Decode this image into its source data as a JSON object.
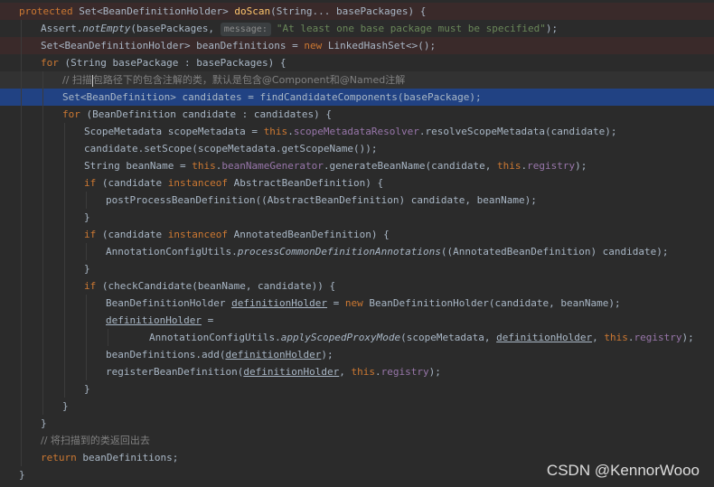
{
  "lines": [
    {
      "indent": 0,
      "hl": "hl-red",
      "segs": [
        {
          "t": "protected",
          "c": "kw"
        },
        {
          "t": " Set<BeanDefinitionHolder> "
        },
        {
          "t": "doScan",
          "c": "fn"
        },
        {
          "t": "(String... basePackages) {"
        }
      ]
    },
    {
      "indent": 1,
      "hl": "",
      "segs": [
        {
          "t": "Assert."
        },
        {
          "t": "notEmpty",
          "c": "it"
        },
        {
          "t": "(basePackages, "
        },
        {
          "t": "message:",
          "c": "hint"
        },
        {
          "t": "\"At least one base package must be specified\"",
          "c": "str"
        },
        {
          "t": ");"
        }
      ]
    },
    {
      "indent": 1,
      "hl": "hl-red",
      "segs": [
        {
          "t": "Set<BeanDefinitionHolder> beanDefinitions = "
        },
        {
          "t": "new",
          "c": "kw"
        },
        {
          "t": " LinkedHashSet<>();"
        }
      ]
    },
    {
      "indent": 1,
      "hl": "",
      "segs": [
        {
          "t": "for",
          "c": "kw"
        },
        {
          "t": " (String basePackage : basePackages) {"
        }
      ]
    },
    {
      "indent": 2,
      "hl": "hl-dim",
      "segs": [
        {
          "t": "// 扫描",
          "c": "cmt cjk"
        },
        {
          "t": "",
          "c": "caret"
        },
        {
          "t": "包路径下的包含注解的类，默认是包含@Component和@Named注解",
          "c": "cmt cjk"
        }
      ]
    },
    {
      "indent": 2,
      "hl": "hl-sel",
      "segs": [
        {
          "t": "Set<BeanDefinition> candidates = findCandidateComponents(basePackage);"
        }
      ]
    },
    {
      "indent": 2,
      "hl": "",
      "segs": [
        {
          "t": "for",
          "c": "kw"
        },
        {
          "t": " (BeanDefinition candidate : candidates) {"
        }
      ]
    },
    {
      "indent": 3,
      "hl": "",
      "segs": [
        {
          "t": "ScopeMetadata scopeMetadata = "
        },
        {
          "t": "this",
          "c": "kw"
        },
        {
          "t": "."
        },
        {
          "t": "scopeMetadataResolver",
          "c": "fld"
        },
        {
          "t": ".resolveScopeMetadata(candidate);"
        }
      ]
    },
    {
      "indent": 3,
      "hl": "",
      "segs": [
        {
          "t": "candidate.setScope(scopeMetadata.getScopeName());"
        }
      ]
    },
    {
      "indent": 3,
      "hl": "",
      "segs": [
        {
          "t": "String beanName = "
        },
        {
          "t": "this",
          "c": "kw"
        },
        {
          "t": "."
        },
        {
          "t": "beanNameGenerator",
          "c": "fld"
        },
        {
          "t": ".generateBeanName(candidate, "
        },
        {
          "t": "this",
          "c": "kw"
        },
        {
          "t": "."
        },
        {
          "t": "registry",
          "c": "fld"
        },
        {
          "t": ");"
        }
      ]
    },
    {
      "indent": 3,
      "hl": "",
      "segs": [
        {
          "t": "if",
          "c": "kw"
        },
        {
          "t": " (candidate "
        },
        {
          "t": "instanceof",
          "c": "kw"
        },
        {
          "t": " AbstractBeanDefinition) {"
        }
      ]
    },
    {
      "indent": 4,
      "hl": "",
      "segs": [
        {
          "t": "postProcessBeanDefinition((AbstractBeanDefinition) candidate, beanName);"
        }
      ]
    },
    {
      "indent": 3,
      "hl": "",
      "segs": [
        {
          "t": "}"
        }
      ]
    },
    {
      "indent": 3,
      "hl": "",
      "segs": [
        {
          "t": "if",
          "c": "kw"
        },
        {
          "t": " (candidate "
        },
        {
          "t": "instanceof",
          "c": "kw"
        },
        {
          "t": " AnnotatedBeanDefinition) {"
        }
      ]
    },
    {
      "indent": 4,
      "hl": "",
      "segs": [
        {
          "t": "AnnotationConfigUtils."
        },
        {
          "t": "processCommonDefinitionAnnotations",
          "c": "it"
        },
        {
          "t": "((AnnotatedBeanDefinition) candidate);"
        }
      ]
    },
    {
      "indent": 3,
      "hl": "",
      "segs": [
        {
          "t": "}"
        }
      ]
    },
    {
      "indent": 3,
      "hl": "",
      "segs": [
        {
          "t": "if",
          "c": "kw"
        },
        {
          "t": " (checkCandidate(beanName, candidate)) {"
        }
      ]
    },
    {
      "indent": 4,
      "hl": "",
      "segs": [
        {
          "t": "BeanDefinitionHolder "
        },
        {
          "t": "definitionHolder",
          "c": "ul"
        },
        {
          "t": " = "
        },
        {
          "t": "new",
          "c": "kw"
        },
        {
          "t": " BeanDefinitionHolder(candidate, beanName);"
        }
      ]
    },
    {
      "indent": 4,
      "hl": "",
      "segs": [
        {
          "t": "definitionHolder",
          "c": "ul"
        },
        {
          "t": " ="
        }
      ]
    },
    {
      "indent": 6,
      "hl": "",
      "segs": [
        {
          "t": "AnnotationConfigUtils."
        },
        {
          "t": "applyScopedProxyMode",
          "c": "it"
        },
        {
          "t": "(scopeMetadata, "
        },
        {
          "t": "definitionHolder",
          "c": "ul"
        },
        {
          "t": ", "
        },
        {
          "t": "this",
          "c": "kw"
        },
        {
          "t": "."
        },
        {
          "t": "registry",
          "c": "fld"
        },
        {
          "t": ");"
        }
      ]
    },
    {
      "indent": 4,
      "hl": "",
      "segs": [
        {
          "t": "beanDefinitions.add("
        },
        {
          "t": "definitionHolder",
          "c": "ul"
        },
        {
          "t": ");"
        }
      ]
    },
    {
      "indent": 4,
      "hl": "",
      "segs": [
        {
          "t": "registerBeanDefinition("
        },
        {
          "t": "definitionHolder",
          "c": "ul"
        },
        {
          "t": ", "
        },
        {
          "t": "this",
          "c": "kw"
        },
        {
          "t": "."
        },
        {
          "t": "registry",
          "c": "fld"
        },
        {
          "t": ");"
        }
      ]
    },
    {
      "indent": 3,
      "hl": "",
      "segs": [
        {
          "t": "}"
        }
      ]
    },
    {
      "indent": 2,
      "hl": "",
      "segs": [
        {
          "t": "}"
        }
      ]
    },
    {
      "indent": 1,
      "hl": "",
      "segs": [
        {
          "t": "}"
        }
      ]
    },
    {
      "indent": 1,
      "hl": "",
      "segs": [
        {
          "t": "// 将扫描到的类返回出去",
          "c": "cmt cjk"
        }
      ]
    },
    {
      "indent": 1,
      "hl": "",
      "segs": [
        {
          "t": "return",
          "c": "kw"
        },
        {
          "t": " beanDefinitions;"
        }
      ]
    },
    {
      "indent": 0,
      "hl": "",
      "segs": [
        {
          "t": "}"
        }
      ]
    }
  ],
  "watermark": "CSDN @KennorWooo"
}
